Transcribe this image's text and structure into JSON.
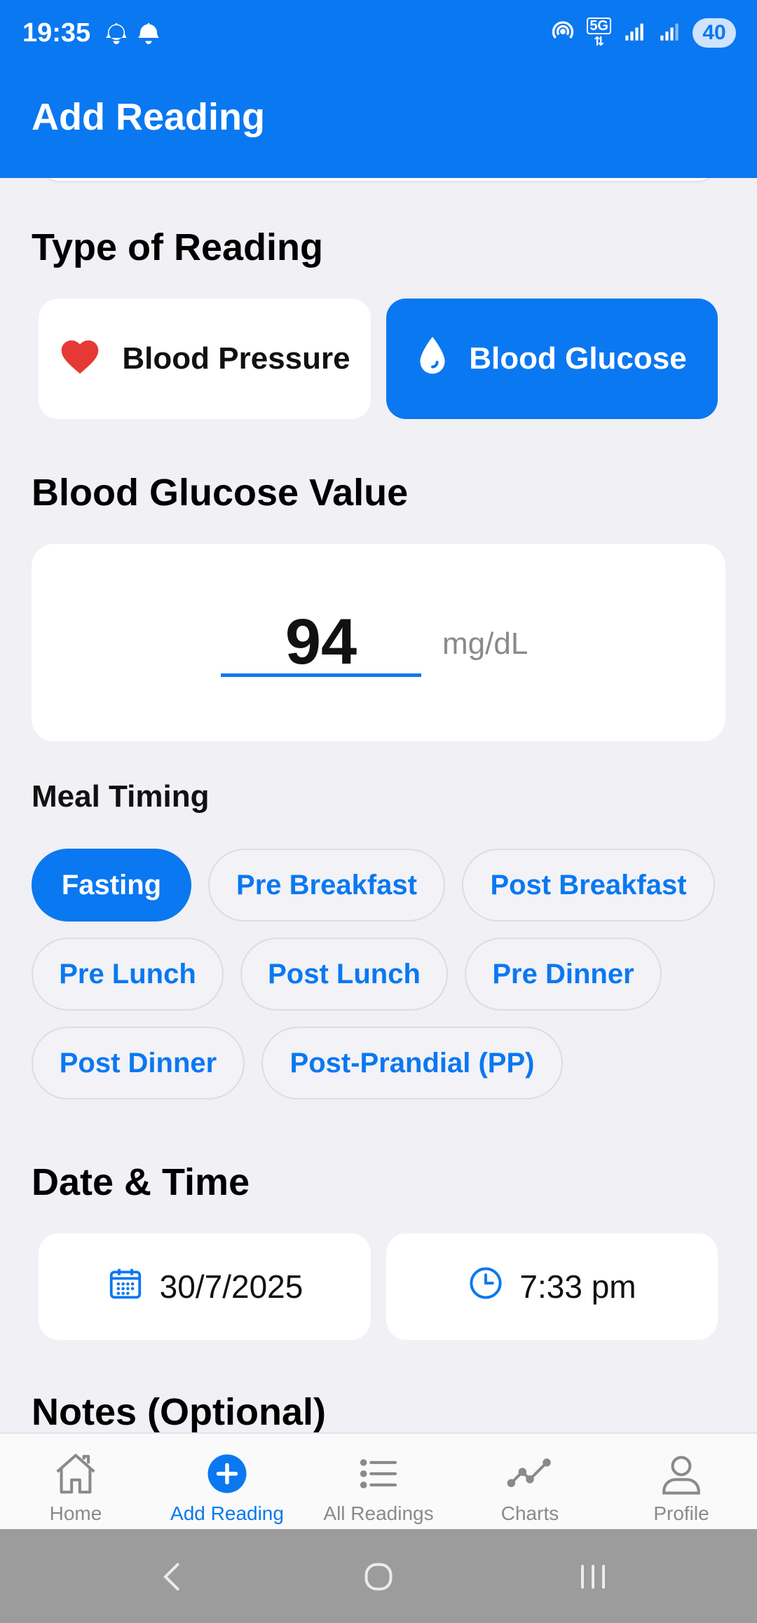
{
  "status": {
    "time": "19:35",
    "battery": "40",
    "network": "5G"
  },
  "app_bar": {
    "title": "Add Reading"
  },
  "type_section": {
    "title": "Type of Reading",
    "options": [
      {
        "label": "Blood Pressure",
        "icon": "heart-icon",
        "selected": false
      },
      {
        "label": "Blood Glucose",
        "icon": "drop-icon",
        "selected": true
      }
    ]
  },
  "value_section": {
    "title": "Blood Glucose Value",
    "value": "94",
    "unit": "mg/dL"
  },
  "meal_timing": {
    "title": "Meal Timing",
    "options": [
      {
        "label": "Fasting",
        "selected": true
      },
      {
        "label": "Pre Breakfast",
        "selected": false
      },
      {
        "label": "Post Breakfast",
        "selected": false
      },
      {
        "label": "Pre Lunch",
        "selected": false
      },
      {
        "label": "Post Lunch",
        "selected": false
      },
      {
        "label": "Pre Dinner",
        "selected": false
      },
      {
        "label": "Post Dinner",
        "selected": false
      },
      {
        "label": "Post-Prandial (PP)",
        "selected": false
      }
    ]
  },
  "datetime": {
    "title": "Date & Time",
    "date": "30/7/2025",
    "time": "7:33 pm"
  },
  "notes": {
    "title": "Notes (Optional)"
  },
  "bottom_nav": [
    {
      "label": "Home",
      "icon": "home-icon",
      "active": false
    },
    {
      "label": "Add Reading",
      "icon": "add-circle-icon",
      "active": true
    },
    {
      "label": "All Readings",
      "icon": "list-icon",
      "active": false
    },
    {
      "label": "Charts",
      "icon": "chart-line-icon",
      "active": false
    },
    {
      "label": "Profile",
      "icon": "person-icon",
      "active": false
    }
  ],
  "colors": {
    "primary": "#0a78f0",
    "background": "#f0f0f5",
    "heart": "#e53935"
  }
}
